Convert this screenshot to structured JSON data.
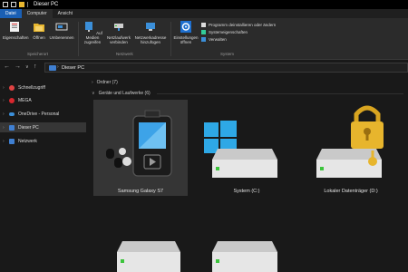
{
  "window": {
    "title": "Dieser PC"
  },
  "tabs": [
    {
      "label": "Datei"
    },
    {
      "label": "Computer"
    },
    {
      "label": "Ansicht"
    }
  ],
  "ribbon": {
    "location_group": {
      "label": "Speicherort",
      "buttons": [
        {
          "label": "Eigenschaften",
          "icon": "properties-icon"
        },
        {
          "label": "Öffnen",
          "icon": "open-folder-icon"
        },
        {
          "label": "Umbenennen",
          "icon": "rename-icon"
        }
      ]
    },
    "network_group": {
      "label": "Netzwerk",
      "buttons": [
        {
          "label": "Auf Medien zugreifen",
          "icon": "media-icon"
        },
        {
          "label": "Netzlaufwerk verbinden",
          "icon": "network-drive-icon"
        },
        {
          "label": "Netzwerkadresse hinzufügen",
          "icon": "network-location-icon"
        }
      ]
    },
    "system_group": {
      "label": "System",
      "big_button": {
        "label": "Einstellungen öffnen",
        "icon": "gear-icon"
      },
      "small_buttons": [
        {
          "label": "Programm deinstallieren oder ändern",
          "icon": "uninstall-icon"
        },
        {
          "label": "Systemeigenschaften",
          "icon": "check-icon"
        },
        {
          "label": "Verwalten",
          "icon": "manage-icon"
        }
      ]
    }
  },
  "address": {
    "breadcrumb": "Dieser PC"
  },
  "sidebar": {
    "items": [
      {
        "label": "Schnellzugriff",
        "icon": "star-icon",
        "color": "#e04343"
      },
      {
        "label": "MEGA",
        "icon": "mega-icon",
        "color": "#d9272e"
      },
      {
        "label": "OneDrive - Personal",
        "icon": "cloud-icon",
        "color": "#3b8fd9"
      },
      {
        "label": "Dieser PC",
        "icon": "pc-icon",
        "color": "#3f7fd1",
        "selected": true
      },
      {
        "label": "Netzwerk",
        "icon": "network-icon",
        "color": "#3f7fd1"
      }
    ]
  },
  "main": {
    "folders_header": "Ordner (7)",
    "devices_header": "Geräte und Laufwerke (6)",
    "devices": [
      {
        "label": "Samsung Galaxy S7",
        "icon": "phone-icon"
      },
      {
        "label": "System (C:)",
        "icon": "windows-drive-icon"
      },
      {
        "label": "Lokaler Datenträger (D:)",
        "icon": "locked-drive-icon"
      },
      {
        "label": "",
        "icon": "drive-icon"
      },
      {
        "label": "",
        "icon": "drive-icon"
      }
    ]
  },
  "colors": {
    "accent": "#1a5fb4",
    "background": "#191919",
    "ribbon": "#2b2b2b",
    "selection": "#353535"
  }
}
